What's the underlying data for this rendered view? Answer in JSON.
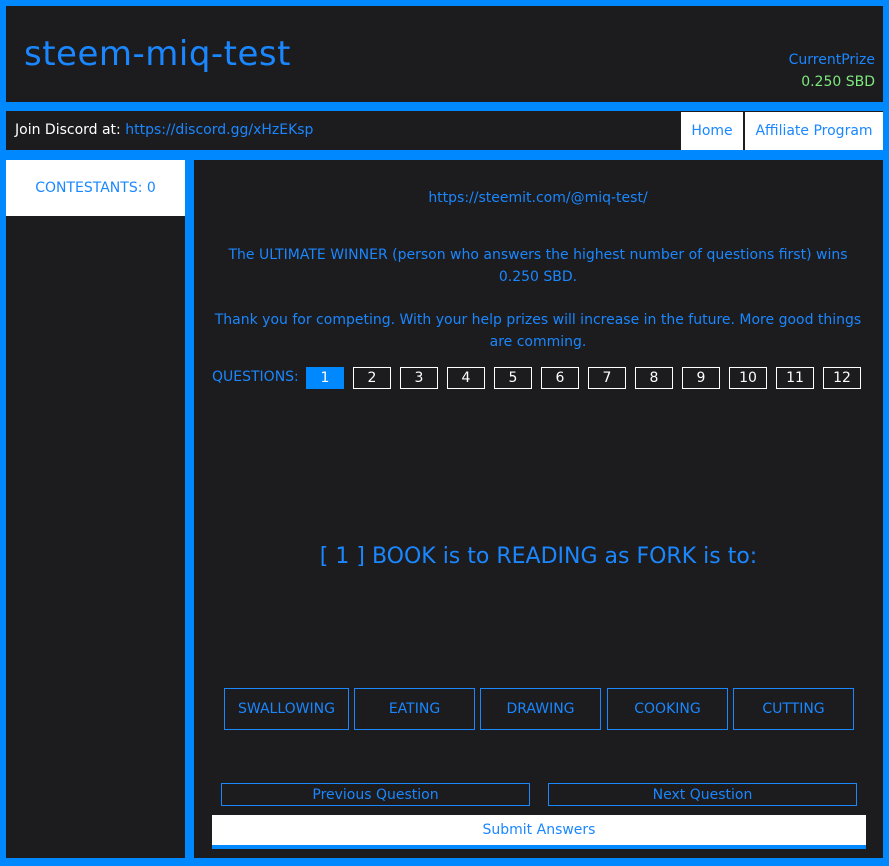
{
  "header": {
    "title": "steem-miq-test",
    "prize_label": "CurrentPrize",
    "prize_value": "0.250 SBD"
  },
  "nav": {
    "discord_label": "Join Discord at: ",
    "discord_url": "https://discord.gg/xHzEKsp",
    "home": "Home",
    "affiliate": "Affiliate Program"
  },
  "sidebar": {
    "contestants": "CONTESTANTS: 0"
  },
  "main": {
    "steemit_url": "https://steemit.com/@miq-test/",
    "winner_text": "The ULTIMATE WINNER (person who answers the highest number of questions first) wins 0.250 SBD.",
    "thanks_text": "Thank you for competing. With your help prizes will increase in the future. More good things are comming.",
    "questions_label": "QUESTIONS:",
    "questions": [
      "1",
      "2",
      "3",
      "4",
      "5",
      "6",
      "7",
      "8",
      "9",
      "10",
      "11",
      "12"
    ],
    "active_question": 1,
    "question_text": "[ 1 ] BOOK is to READING as FORK is to:",
    "answers": [
      "SWALLOWING",
      "EATING",
      "DRAWING",
      "COOKING",
      "CUTTING"
    ],
    "prev_label": "Previous Question",
    "next_label": "Next Question",
    "submit_label": "Submit Answers"
  }
}
